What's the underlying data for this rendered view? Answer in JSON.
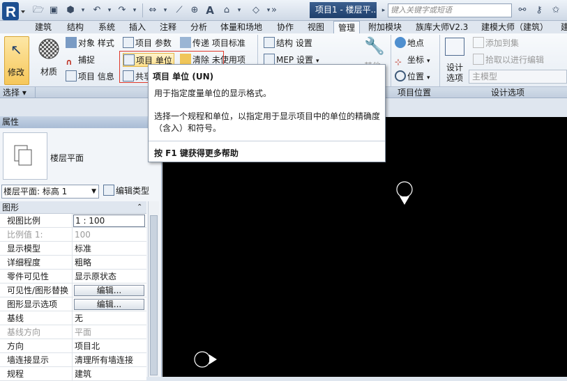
{
  "titlebar": {
    "doc_title": "项目1 - 楼层平...",
    "search_placeholder": "键入关键字或短语"
  },
  "tabs": [
    "建筑",
    "结构",
    "系统",
    "插入",
    "注释",
    "分析",
    "体量和场地",
    "协作",
    "视图",
    "管理",
    "附加模块",
    "族库大师V2.3",
    "建模大师（建筑）",
    "建"
  ],
  "active_tab": "管理",
  "ribbon": {
    "modify_label": "修改",
    "material_label": "材质",
    "object_style": "对象 样式",
    "snap": "捕捉",
    "project_info": "项目 信息",
    "project_params": "项目 参数",
    "project_units": "项目 单位",
    "shared_partial": "共享",
    "transfer_standards": "传递 项目标准",
    "purge_unused": "清除 未使用项",
    "structural_settings": "结构 设置",
    "mep_settings": "MEP 设置",
    "other_settings_partial": "其他",
    "location": "地点",
    "coordinates": "坐标",
    "position": "位置",
    "design_options_label": "设计\n选项",
    "add_to_set": "添加到集",
    "pick_to_edit": "拾取以进行编辑",
    "main_model": "主模型"
  },
  "panels": {
    "select": "选择 ▾",
    "project_location": "项目位置",
    "design_options": "设计选项"
  },
  "tooltip": {
    "title": "项目 单位 (UN)",
    "line1": "用于指定度量单位的显示格式。",
    "line2": "选择一个规程和单位，以指定用于显示项目中的单位的精确度（含入）和符号。",
    "help": "按 F1 键获得更多帮助"
  },
  "properties": {
    "header": "属性",
    "type_name": "楼层平面",
    "type_select": "楼层平面: 标高 1",
    "edit_type": "编辑类型",
    "group": "图形",
    "rows": [
      {
        "name": "视图比例",
        "value": "1 : 100",
        "kind": "input"
      },
      {
        "name": "比例值 1:",
        "value": "100",
        "kind": "grey"
      },
      {
        "name": "显示模型",
        "value": "标准",
        "kind": "text"
      },
      {
        "name": "详细程度",
        "value": "粗略",
        "kind": "text"
      },
      {
        "name": "零件可见性",
        "value": "显示原状态",
        "kind": "text"
      },
      {
        "name": "可见性/图形替换",
        "value": "编辑...",
        "kind": "button"
      },
      {
        "name": "图形显示选项",
        "value": "编辑...",
        "kind": "button"
      },
      {
        "name": "基线",
        "value": "无",
        "kind": "text"
      },
      {
        "name": "基线方向",
        "value": "平面",
        "kind": "grey"
      },
      {
        "name": "方向",
        "value": "项目北",
        "kind": "text"
      },
      {
        "name": "墙连接显示",
        "value": "清理所有墙连接",
        "kind": "text"
      },
      {
        "name": "规程",
        "value": "建筑",
        "kind": "text"
      }
    ]
  },
  "colors": {
    "canvas": "#000000",
    "highlight": "#e0392b",
    "title_accent": "#1f3f6b"
  }
}
